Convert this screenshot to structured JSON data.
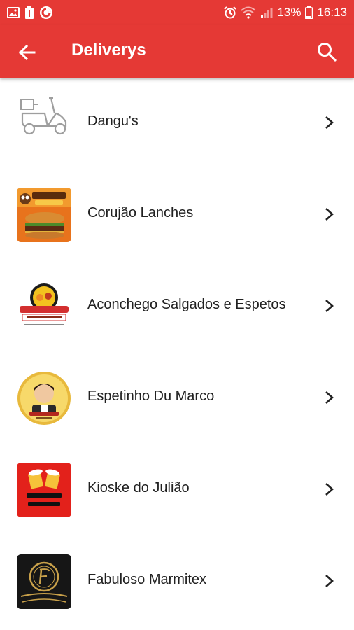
{
  "status_bar": {
    "left_icons": [
      "image-icon",
      "battery-alert-icon",
      "ring-icon"
    ],
    "right_icons": [
      "alarm-icon",
      "wifi-icon",
      "signal-icon"
    ],
    "battery_percent": "13%",
    "time": "16:13"
  },
  "app_bar": {
    "title": "Deliverys",
    "back_icon": "arrow-back-icon",
    "search_icon": "search-icon",
    "background": "#e53935"
  },
  "deliveries": [
    {
      "name": "Dangu's",
      "logo_icon": "scooter-icon"
    },
    {
      "name": "Corujão Lanches",
      "logo_icon": "burger-logo"
    },
    {
      "name": "Aconchego Salgados e Espetos",
      "logo_icon": "aconchego-logo"
    },
    {
      "name": "Espetinho Du Marco",
      "logo_icon": "chef-badge-logo"
    },
    {
      "name": "Kioske do Julião",
      "logo_icon": "beer-mugs-logo"
    },
    {
      "name": "Fabuloso Marmitex",
      "logo_icon": "fabuloso-emblem-logo"
    }
  ]
}
